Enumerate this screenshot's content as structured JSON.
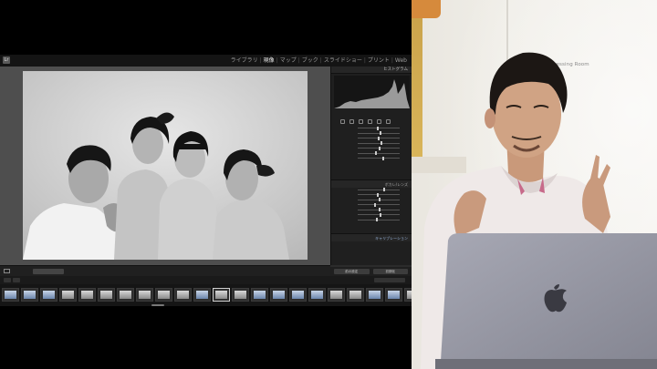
{
  "lightroom": {
    "identity_line1": "",
    "identity_line2": "",
    "logo_text": "Lr",
    "modules": [
      {
        "label": "ライブラリ",
        "active": false
      },
      {
        "label": "現像",
        "active": true
      },
      {
        "label": "マップ",
        "active": false
      },
      {
        "label": "ブック",
        "active": false
      },
      {
        "label": "スライドショー",
        "active": false
      },
      {
        "label": "プリント",
        "active": false
      },
      {
        "label": "Web",
        "active": false
      }
    ],
    "panels": {
      "histogram": "ヒストグラム",
      "lens": "ボカレ/レンズ",
      "calibration": "キャリブレーション"
    },
    "buttons": {
      "previous": "前の設定",
      "reset": "初期化"
    }
  },
  "camera": {
    "sign": "Dressing Room"
  },
  "colors": {
    "lr_bg": "#2b2b2b",
    "lr_panel": "#1f1f1f",
    "photo_bg": "#cfcfcf",
    "wall": "#f0eee8",
    "laptop": "#9a9aa6"
  }
}
